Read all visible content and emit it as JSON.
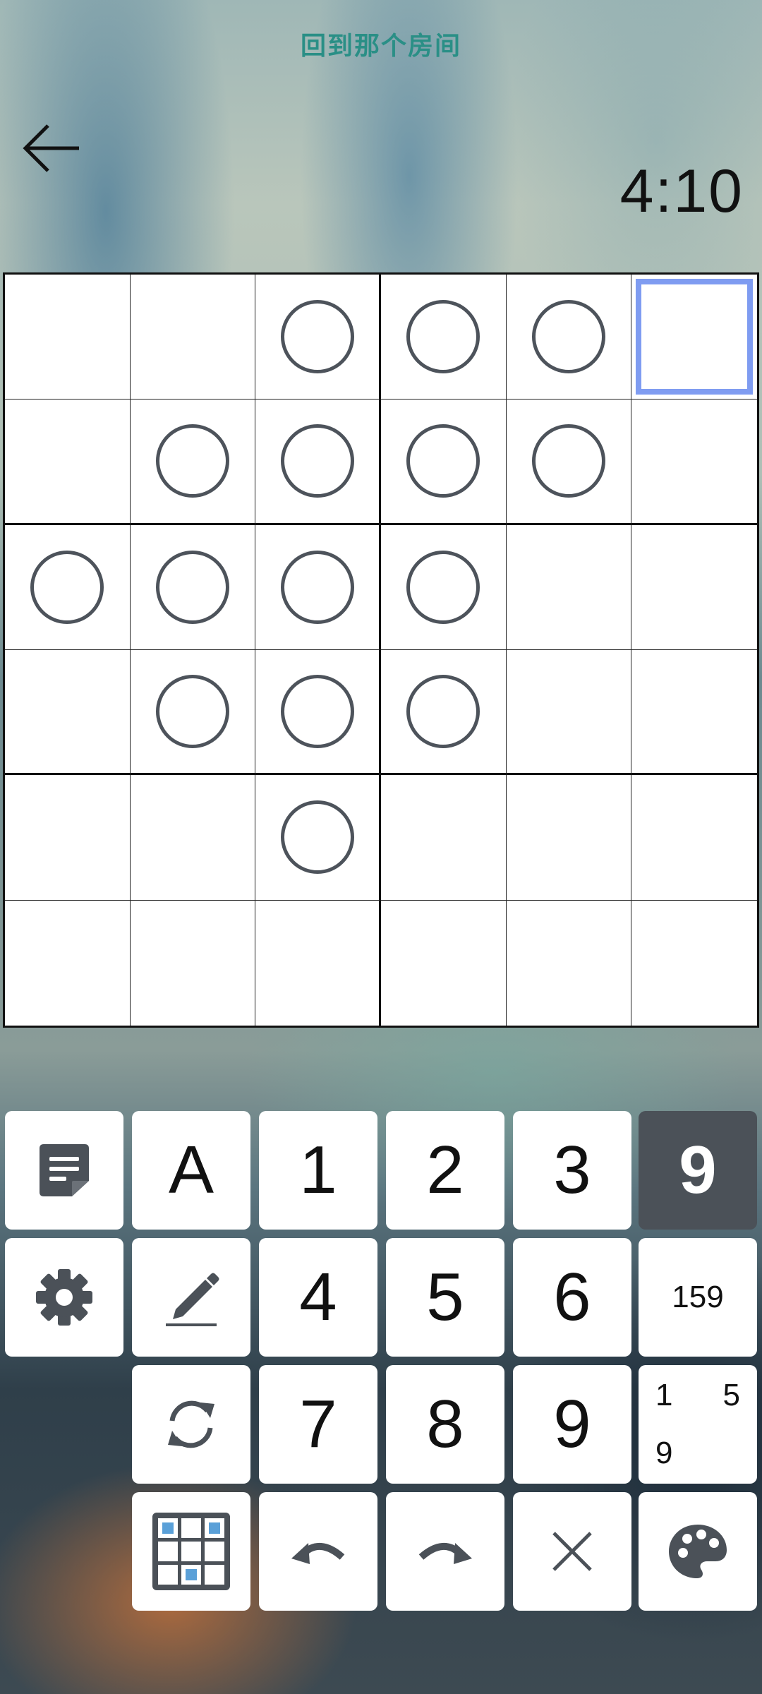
{
  "header": {
    "title": "回到那个房间",
    "timer": "4:10"
  },
  "board": {
    "size": 6,
    "selected_cell": [
      0,
      5
    ],
    "circles": [
      [
        0,
        2
      ],
      [
        0,
        3
      ],
      [
        0,
        4
      ],
      [
        1,
        1
      ],
      [
        1,
        2
      ],
      [
        1,
        3
      ],
      [
        1,
        4
      ],
      [
        2,
        0
      ],
      [
        2,
        1
      ],
      [
        2,
        2
      ],
      [
        2,
        3
      ],
      [
        3,
        1
      ],
      [
        3,
        2
      ],
      [
        3,
        3
      ],
      [
        4,
        2
      ]
    ]
  },
  "keypad": {
    "notes_icon": "notes-icon",
    "letter_key": "A",
    "digits": [
      "1",
      "2",
      "3",
      "4",
      "5",
      "6",
      "7",
      "8",
      "9"
    ],
    "active_digit": "9",
    "settings_icon": "gear-icon",
    "pencil_icon": "pencil-icon",
    "candidate_inline": "159",
    "candidate_corner": [
      "1",
      "5",
      "9"
    ],
    "refresh_icon": "refresh-icon",
    "grid_icon": "grid-icon",
    "undo_icon": "undo-icon",
    "redo_icon": "redo-icon",
    "clear_icon": "close-icon",
    "palette_icon": "palette-icon"
  },
  "colors": {
    "title": "#2a8f86",
    "selection": "#7f9cf1",
    "circle": "#4d535b",
    "active_key": "#4b5158"
  }
}
